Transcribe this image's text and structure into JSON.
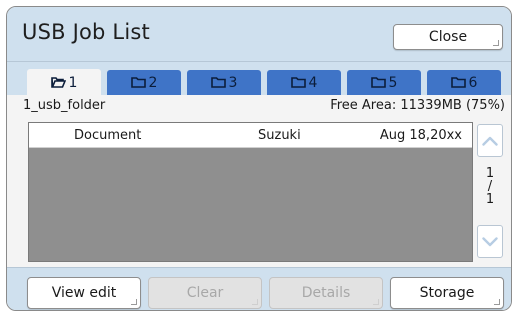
{
  "window": {
    "title": "USB Job List",
    "close_label": "Close"
  },
  "tabs": [
    {
      "label": "1",
      "icon": "open-folder-icon",
      "active": true
    },
    {
      "label": "2",
      "icon": "folder-icon",
      "active": false
    },
    {
      "label": "3",
      "icon": "folder-icon",
      "active": false
    },
    {
      "label": "4",
      "icon": "folder-icon",
      "active": false
    },
    {
      "label": "5",
      "icon": "folder-icon",
      "active": false
    },
    {
      "label": "6",
      "icon": "folder-icon",
      "active": false
    }
  ],
  "info": {
    "folder_name": "1_usb_folder",
    "free_area": "Free Area: 11339MB (75%)"
  },
  "jobs": [
    {
      "document": "Document",
      "owner": "Suzuki",
      "date": "Aug 18,20xx"
    }
  ],
  "pager": {
    "current": "1",
    "separator": "/",
    "total": "1"
  },
  "footer": {
    "view_edit": "View edit",
    "clear": "Clear",
    "details": "Details",
    "storage": "Storage"
  },
  "colors": {
    "tab_active_bg": "#f4f4f4",
    "tab_bg": "#3f74c7",
    "header_bg": "#cfe0ee",
    "list_bg": "#8f8f8f"
  }
}
